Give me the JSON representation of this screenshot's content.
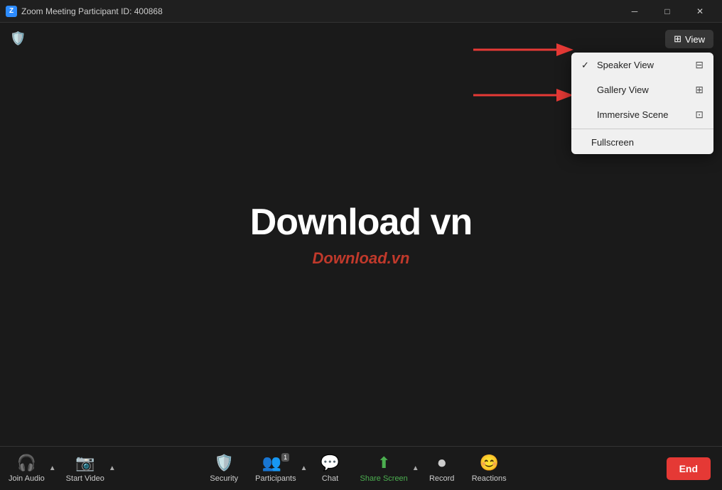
{
  "titlebar": {
    "title": "Zoom Meeting Participant ID: 400868",
    "app_icon": "Z",
    "minimize_label": "─",
    "maximize_label": "□",
    "close_label": "✕"
  },
  "header": {
    "view_button_label": "View"
  },
  "dropdown": {
    "speaker_view": "Speaker View",
    "gallery_view": "Gallery View",
    "immersive_scene": "Immersive Scene",
    "fullscreen": "Fullscreen"
  },
  "main": {
    "center_title": "Download vn",
    "center_subtitle": "Download.vn"
  },
  "toolbar": {
    "join_audio": "Join Audio",
    "start_video": "Start Video",
    "security": "Security",
    "participants": "Participants",
    "participants_count": "1",
    "chat": "Chat",
    "share_screen": "Share Screen",
    "record": "Record",
    "reactions": "Reactions",
    "end": "End"
  }
}
